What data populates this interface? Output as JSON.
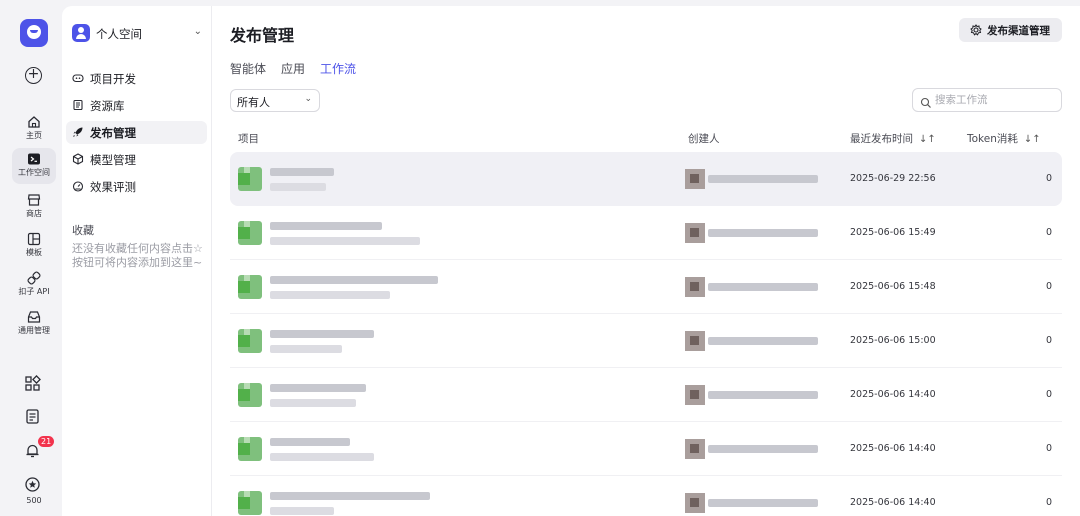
{
  "rail": {
    "home_label": "主页",
    "workspace_label": "工作空间",
    "store_label": "商店",
    "template_label": "模板",
    "api_label": "扣子 API",
    "general_label": "通用管理",
    "notification_count": "21",
    "credit": "500"
  },
  "sidebar": {
    "space_name": "个人空间",
    "items": [
      {
        "label": "项目开发",
        "icon": "gamepad-icon"
      },
      {
        "label": "资源库",
        "icon": "library-icon"
      },
      {
        "label": "发布管理",
        "icon": "rocket-icon"
      },
      {
        "label": "模型管理",
        "icon": "cube-icon"
      },
      {
        "label": "效果评测",
        "icon": "gauge-icon"
      }
    ],
    "favorites_title": "收藏",
    "favorites_hint": "还没有收藏任何内容点击☆按钮可将内容添加到这里~"
  },
  "main": {
    "title": "发布管理",
    "channel_button": "发布渠道管理",
    "tabs": [
      "智能体",
      "应用",
      "工作流"
    ],
    "active_tab": "工作流",
    "owner_filter": "所有人",
    "search_placeholder": "搜索工作流",
    "columns": {
      "project": "项目",
      "creator": "创建人",
      "last_publish": "最近发布时间",
      "token": "Token消耗"
    },
    "rows": [
      {
        "time": "2025-06-29 22:56",
        "token": "0"
      },
      {
        "time": "2025-06-06 15:49",
        "token": "0"
      },
      {
        "time": "2025-06-06 15:48",
        "token": "0"
      },
      {
        "time": "2025-06-06 15:00",
        "token": "0"
      },
      {
        "time": "2025-06-06 14:40",
        "token": "0"
      },
      {
        "time": "2025-06-06 14:40",
        "token": "0"
      },
      {
        "time": "2025-06-06 14:40",
        "token": "0"
      }
    ]
  }
}
